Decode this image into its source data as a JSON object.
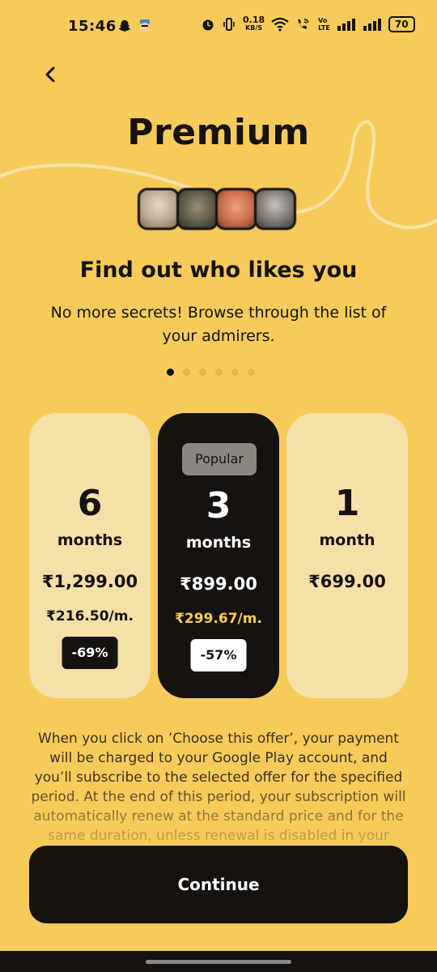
{
  "status_bar": {
    "time": "15:46",
    "net_speed_value": "0.18",
    "net_speed_unit": "KB/S",
    "volte": "Vo\nLTE",
    "battery": "70"
  },
  "header": {
    "back_icon": "chevron-left-icon",
    "title": "Premium"
  },
  "feature": {
    "headline": "Find out who likes you",
    "description": "No more secrets! Browse through the list of your admirers.",
    "dots_total": 6,
    "dots_active": 0
  },
  "plans": [
    {
      "number": "6",
      "unit": "months",
      "price": "₹1,299.00",
      "per_month": "₹216.50/m.",
      "discount": "-69%"
    },
    {
      "badge": "Popular",
      "number": "3",
      "unit": "months",
      "price": "₹899.00",
      "per_month": "₹299.67/m.",
      "discount": "-57%"
    },
    {
      "number": "1",
      "unit": "month",
      "price": "₹699.00"
    }
  ],
  "disclaimer": "When you click on ’Choose this offer’, your payment will be charged to your Google Play account, and you’ll subscribe to the selected offer for the specified period. At the end of this period, your subscription will automatically renew at the standard price and for the same duration, unless renewal is disabled in your",
  "cta": {
    "label": "Continue"
  },
  "colors": {
    "background": "#f6cb5a",
    "dark": "#151210",
    "card_light": "#f5e0a8",
    "accent_price": "#f6cb5a"
  }
}
